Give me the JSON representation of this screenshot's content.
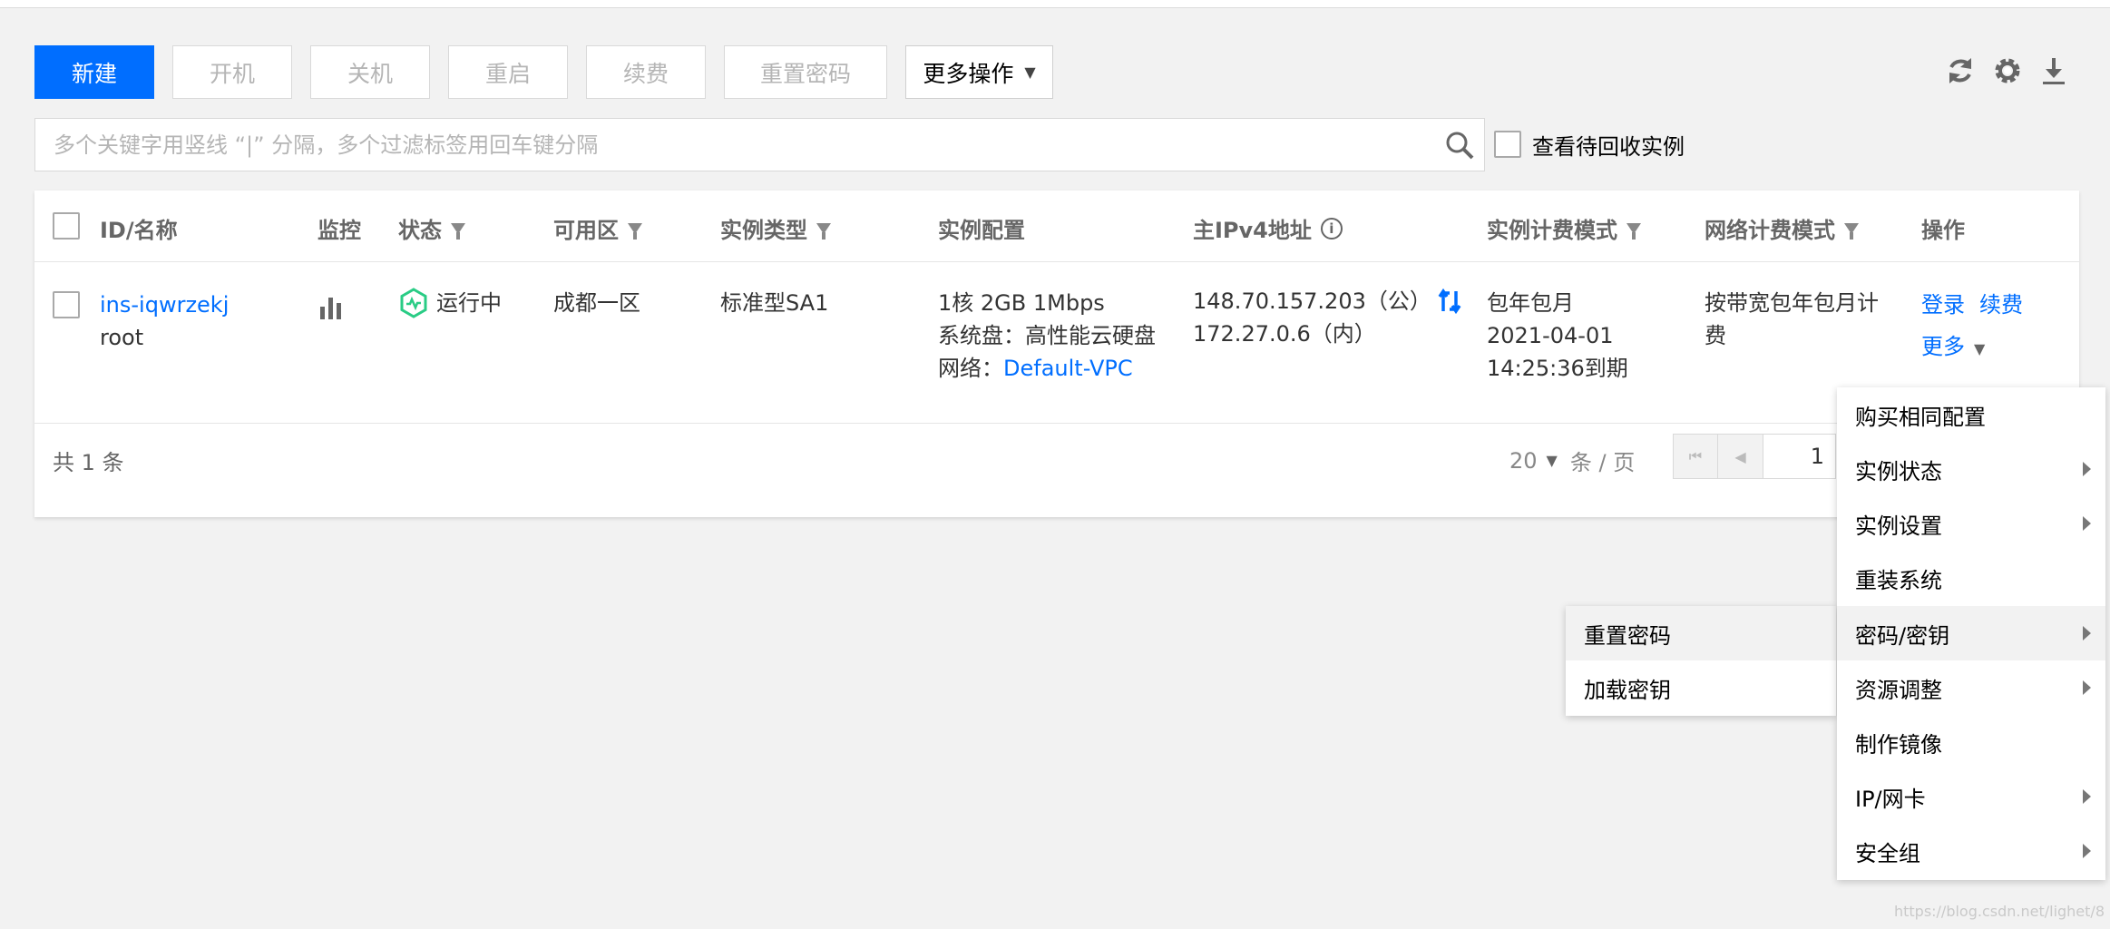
{
  "toolbar": {
    "new_label": "新建",
    "start_label": "开机",
    "shutdown_label": "关机",
    "restart_label": "重启",
    "renew_label": "续费",
    "reset_password_label": "重置密码",
    "more_actions_label": "更多操作"
  },
  "toolbar_icons": [
    "refresh-icon",
    "gear-icon",
    "download-icon"
  ],
  "search": {
    "placeholder": "多个关键字用竖线 “|” 分隔，多个过滤标签用回车键分隔",
    "value": ""
  },
  "recycle": {
    "label": "查看待回收实例",
    "checked": false
  },
  "table": {
    "headers": {
      "id_name": "ID/名称",
      "monitor": "监控",
      "status": "状态",
      "zone": "可用区",
      "instance_type": "实例类型",
      "config": "实例配置",
      "ipv4": "主IPv4地址",
      "billing": "实例计费模式",
      "network_billing": "网络计费模式",
      "actions": "操作"
    },
    "rows": [
      {
        "id": "ins-iqwrzekj",
        "name": "root",
        "status": "运行中",
        "zone": "成都一区",
        "instance_type": "标准型SA1",
        "config_line1": "1核 2GB 1Mbps",
        "config_line2": "系统盘：高性能云硬盘",
        "config_network_label": "网络：",
        "config_network_link": "Default-VPC",
        "ip_public": "148.70.157.203（公）",
        "ip_private": "172.27.0.6（内）",
        "billing_line1": "包年包月",
        "billing_line2": "2021-04-01",
        "billing_line3": "14:25:36到期",
        "network_billing_line1": "按带宽包年包月计",
        "network_billing_line2": "费",
        "action_login": "登录",
        "action_renew": "续费",
        "action_more": "更多"
      }
    ]
  },
  "footer": {
    "total_text": "共  1  条",
    "page_size": "20",
    "page_size_unit": "条 / 页",
    "page_number": "1"
  },
  "more_menu": {
    "items": [
      {
        "label": "购买相同配置",
        "has_submenu": false
      },
      {
        "label": "实例状态",
        "has_submenu": true
      },
      {
        "label": "实例设置",
        "has_submenu": true
      },
      {
        "label": "重装系统",
        "has_submenu": false
      },
      {
        "label": "密码/密钥",
        "has_submenu": true
      },
      {
        "label": "资源调整",
        "has_submenu": true
      },
      {
        "label": "制作镜像",
        "has_submenu": false
      },
      {
        "label": "IP/网卡",
        "has_submenu": true
      },
      {
        "label": "安全组",
        "has_submenu": true
      }
    ],
    "active_item": "密码/密钥"
  },
  "submenu": {
    "items": [
      {
        "label": "重置密码"
      },
      {
        "label": "加载密钥"
      }
    ],
    "active_item": "重置密码"
  },
  "colors": {
    "primary": "#006eff",
    "link": "#006eff",
    "status_running": "#29cc85"
  },
  "watermark": "https://blog.csdn.net/lighet/8"
}
